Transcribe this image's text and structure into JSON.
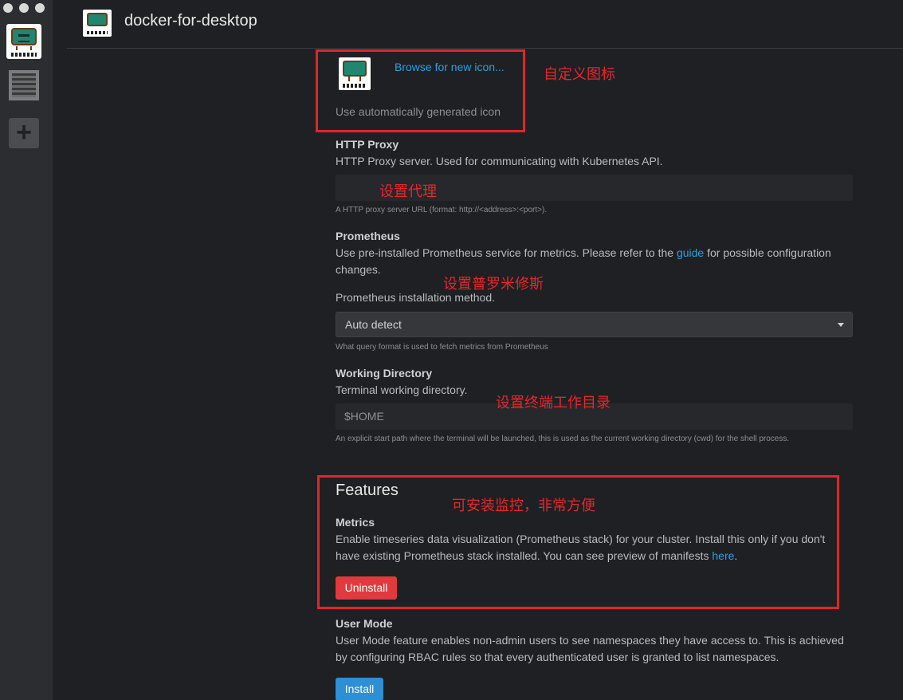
{
  "window": {
    "controls": [
      "close",
      "minimize",
      "zoom"
    ]
  },
  "rail": {
    "items": [
      "cluster-avatar",
      "qr-code",
      "add-cluster"
    ],
    "add_label": "+"
  },
  "header": {
    "cluster_name": "docker-for-desktop"
  },
  "icon_settings": {
    "browse_label": "Browse for new icon...",
    "auto_label": "Use automatically generated icon"
  },
  "http_proxy": {
    "label": "HTTP Proxy",
    "description": "HTTP Proxy server. Used for communicating with Kubernetes API.",
    "value": "",
    "hint": "A HTTP proxy server URL (format: http://<address>:<port>)."
  },
  "prometheus": {
    "label": "Prometheus",
    "description_before": "Use pre-installed Prometheus service for metrics. Please refer to the ",
    "guide_link": "guide",
    "description_after": " for possible configuration changes.",
    "method_label": "Prometheus installation method.",
    "selected": "Auto detect",
    "hint": "What query format is used to fetch metrics from Prometheus"
  },
  "working_directory": {
    "label": "Working Directory",
    "description": "Terminal working directory.",
    "placeholder": "$HOME",
    "hint": "An explicit start path where the terminal will be launched, this is used as the current working directory (cwd) for the shell process."
  },
  "features": {
    "title": "Features",
    "metrics": {
      "label": "Metrics",
      "description_before": "Enable timeseries data visualization (Prometheus stack) for your cluster. Install this only if you don't have existing Prometheus stack installed. You can see preview of manifests ",
      "here_link": "here",
      "description_after": ".",
      "button": "Uninstall"
    },
    "user_mode": {
      "label": "User Mode",
      "description": "User Mode feature enables non-admin users to see namespaces they have access to. This is achieved by configuring RBAC rules so that every authenticated user is granted to list namespaces.",
      "button": "Install"
    }
  },
  "annotations": {
    "icon": "自定义图标",
    "proxy": "设置代理",
    "prometheus": "设置普罗米修斯",
    "workdir": "设置终端工作目录",
    "features": "可安装监控，非常方便"
  },
  "colors": {
    "accent": "#2f9fe0",
    "danger": "#e03a3e",
    "primary": "#2d8fd5",
    "annotation": "#e0262b"
  }
}
